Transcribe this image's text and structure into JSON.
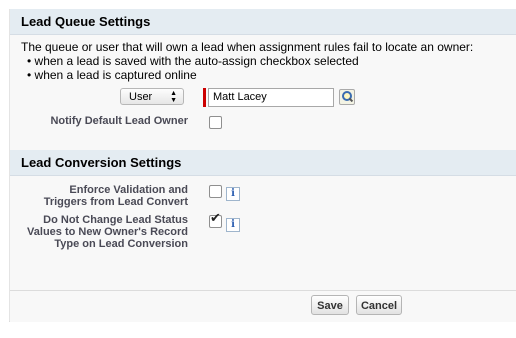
{
  "lead_queue": {
    "title": "Lead Queue Settings",
    "intro": "The queue or user that will own a lead when assignment rules fail to locate an owner:",
    "bullets": [
      "• when a lead is saved with the auto-assign checkbox selected",
      "• when a lead is captured online"
    ],
    "owner_type": "User",
    "owner_name": "Matt Lacey",
    "notify_label": "Notify Default Lead Owner",
    "notify_checked": false
  },
  "lead_conversion": {
    "title": "Lead Conversion Settings",
    "enforce_label_line1": "Enforce Validation and",
    "enforce_label_line2": "Triggers from Lead Convert",
    "enforce_checked": false,
    "status_label_line1": "Do Not Change Lead Status",
    "status_label_line2": "Values to New Owner's Record",
    "status_label_line3": "Type on Lead Conversion",
    "status_checked": true,
    "info_glyph": "i"
  },
  "footer": {
    "save_label": "Save",
    "cancel_label": "Cancel"
  },
  "icons": {
    "select_arrows": "▲▼",
    "checkmark": "✔"
  }
}
